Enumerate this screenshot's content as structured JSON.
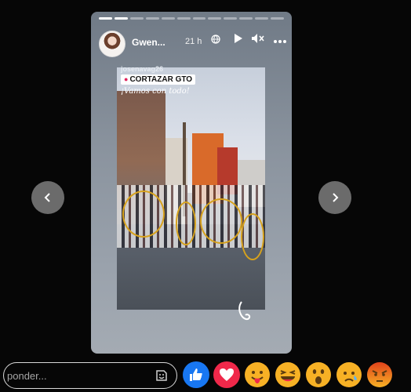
{
  "story": {
    "author": "Gwen...",
    "time": "21 h",
    "icons": [
      "globe-icon",
      "play-icon",
      "mute-icon",
      "more-icon"
    ],
    "progress": {
      "segments": 12,
      "completed": 2
    },
    "overlay": {
      "username": "josenavag26",
      "location": "CORTAZAR GTO",
      "caption": "¡Vamos con todo!"
    }
  },
  "navigation": {
    "prev_icon": "chevron-left-icon",
    "next_icon": "chevron-right-icon"
  },
  "reply": {
    "placeholder": "ponder...",
    "sticker_icon": "sticker-icon"
  },
  "reactions": [
    {
      "name": "like",
      "color": "#1877f2"
    },
    {
      "name": "love",
      "color": "#f0284a"
    },
    {
      "name": "care",
      "color": "#f7b125"
    },
    {
      "name": "haha",
      "color": "#f7b125"
    },
    {
      "name": "wow",
      "color": "#f7b125"
    },
    {
      "name": "sad",
      "color": "#f7b125"
    },
    {
      "name": "angry",
      "color": "#e9710f"
    }
  ]
}
